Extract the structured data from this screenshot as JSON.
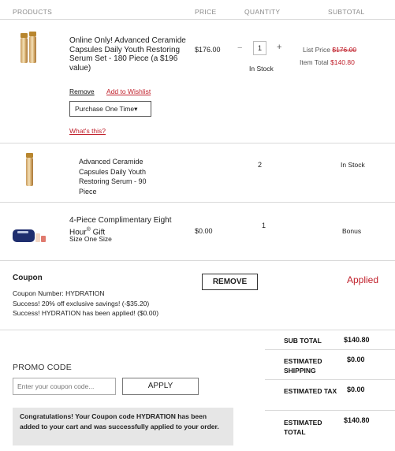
{
  "headers": {
    "products": "PRODUCTS",
    "price": "PRICE",
    "quantity": "QUANTITY",
    "subtotal": "SUBTOTAL"
  },
  "item1": {
    "name": "Online Only! Advanced Ceramide Capsules Daily Youth Restoring Serum Set - 180 Piece (a $196 value)",
    "price": "$176.00",
    "qty": "1",
    "minus": "−",
    "plus": "+",
    "stock": "In Stock",
    "list_price_label": "List Price",
    "list_price": "$176.00",
    "item_total_label": "Item Total",
    "item_total": "$140.80",
    "remove": "Remove",
    "wishlist": "Add to Wishlist",
    "purchase": "Purchase One Time",
    "whats_this": "What's this?"
  },
  "item2": {
    "name": "Advanced Ceramide Capsules Daily Youth Restoring Serum - 90 Piece",
    "qty": "2",
    "stock": "In Stock"
  },
  "item3": {
    "name_pre": "4-Piece Complimentary Eight Hour",
    "reg": "®",
    "name_post": " Gift",
    "size": "Size One Size",
    "price": "$0.00",
    "qty": "1",
    "status": "Bonus"
  },
  "coupon": {
    "title": "Coupon",
    "number": "Coupon Number: HYDRATION",
    "msg1": "Success! 20% off exclusive savings! (-$35.20)",
    "msg2": "Success! HYDRATION has been applied! ($0.00)",
    "remove": "REMOVE",
    "status": "Applied"
  },
  "promo": {
    "title": "PROMO CODE",
    "placeholder": "Enter your coupon code...",
    "apply": "APPLY",
    "message": "Congratulations! Your Coupon code HYDRATION has been added to your cart and was successfully applied to your order."
  },
  "summary": {
    "subtotal_label": "SUB TOTAL",
    "subtotal": "$140.80",
    "shipping_label": "ESTIMATED SHIPPING",
    "shipping": "$0.00",
    "tax_label": "ESTIMATED TAX",
    "tax": "$0.00",
    "total_label": "ESTIMATED TOTAL",
    "total": "$140.80"
  },
  "colors": {
    "accent_red": "#c0202b",
    "header_gray": "#8a8a8a"
  }
}
